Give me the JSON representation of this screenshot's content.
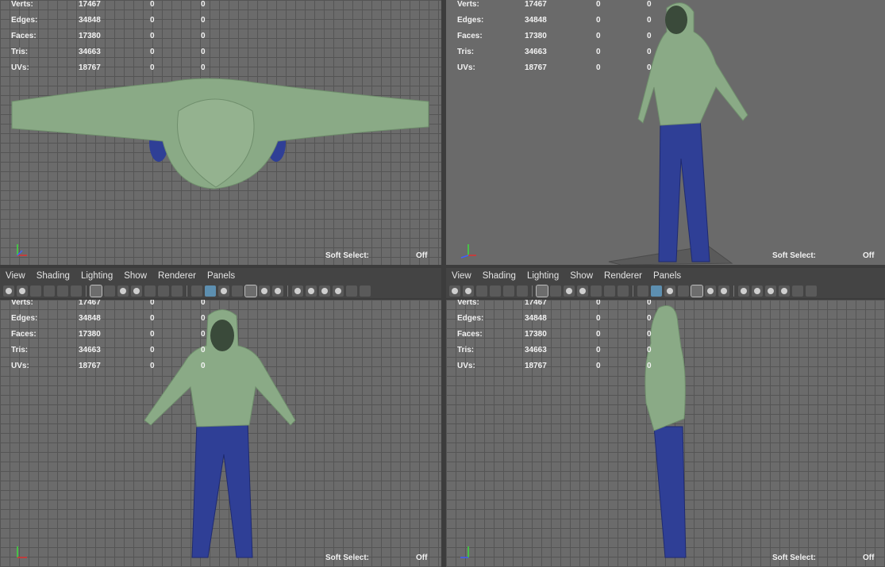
{
  "menu": [
    "View",
    "Shading",
    "Lighting",
    "Show",
    "Renderer",
    "Panels"
  ],
  "hud": {
    "rows": [
      {
        "label": "Verts:",
        "value": "17467",
        "a": "0",
        "b": "0"
      },
      {
        "label": "Edges:",
        "value": "34848",
        "a": "0",
        "b": "0"
      },
      {
        "label": "Faces:",
        "value": "17380",
        "a": "0",
        "b": "0"
      },
      {
        "label": "Tris:",
        "value": "34663",
        "a": "0",
        "b": "0"
      },
      {
        "label": "UVs:",
        "value": "18767",
        "a": "0",
        "b": "0"
      }
    ],
    "soft_select_label": "Soft Select:",
    "soft_select_value": "Off"
  },
  "axis": {
    "x": "x",
    "y": "y",
    "z": "z"
  },
  "icons": [
    "camera-icon",
    "camera-attr-icon",
    "bookmark-icon",
    "image-plane-icon",
    "grid-icon",
    "film-gate-icon",
    "resolution-gate-icon",
    "gate-mask-icon",
    "field-chart-icon",
    "safe-action-icon",
    "safe-title-icon",
    "wireframe-icon",
    "smooth-shade-icon",
    "shade-wire-icon",
    "textured-icon",
    "lights-icon",
    "shadows-icon",
    "screen-ao-icon",
    "motion-blur-icon",
    "aa-icon",
    "dof-icon",
    "isolate-icon",
    "xray-icon"
  ],
  "colors": {
    "hoodie": "#8aaa86",
    "jeans": "#2f3f96",
    "viewport_bg": "#6b6b6b",
    "grid": "#555555"
  }
}
